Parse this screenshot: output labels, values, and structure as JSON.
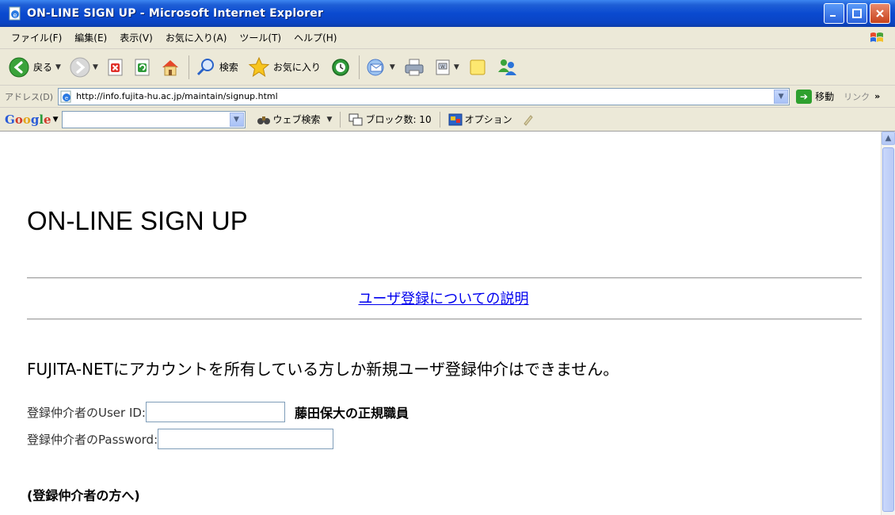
{
  "window": {
    "title": "ON-LINE SIGN UP - Microsoft Internet Explorer",
    "minimize": "_",
    "maximize": "□",
    "close": "×"
  },
  "menu": {
    "items": [
      "ファイル(F)",
      "編集(E)",
      "表示(V)",
      "お気に入り(A)",
      "ツール(T)",
      "ヘルプ(H)"
    ]
  },
  "toolbar": {
    "back_label": "戻る",
    "search_label": "検索",
    "favorites_label": "お気に入り"
  },
  "address": {
    "label": "アドレス(D)",
    "url": "http://info.fujita-hu.ac.jp/maintain/signup.html",
    "go_label": "移動",
    "links_label": "リンク",
    "links_more": "»"
  },
  "google": {
    "web_search_label": "ウェブ検索",
    "popup_block_label": "ブロック数: 10",
    "options_label": "オプション",
    "search_value": ""
  },
  "page": {
    "title": "ON-LINE SIGN UP",
    "help_link": "ユーザ登録についての説明",
    "notice": "FUJITA-NETにアカウントを所有している方しか新規ユーザ登録仲介はできません。",
    "userid_label": "登録仲介者のUser ID:",
    "userid_value": "",
    "staff_note": "藤田保大の正規職員",
    "password_label": "登録仲介者のPassword:",
    "password_value": "",
    "section_heading": "(登録仲介者の方へ)"
  }
}
